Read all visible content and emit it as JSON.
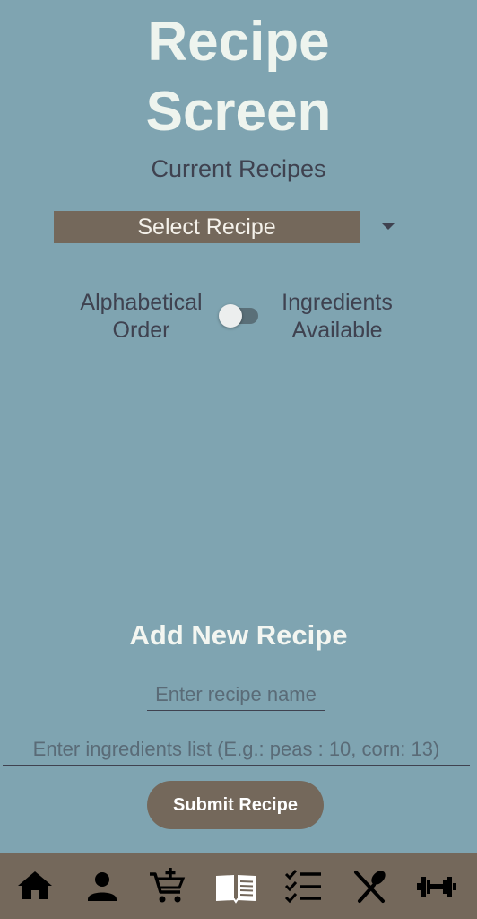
{
  "header": {
    "title_line1": "Recipe",
    "title_line2": "Screen",
    "subtitle": "Current Recipes"
  },
  "recipe_select": {
    "selected": "Select Recipe"
  },
  "sort_toggle": {
    "left_line1": "Alphabetical",
    "left_line2": "Order",
    "right_line1": "Ingredients",
    "right_line2": "Available",
    "state": "off"
  },
  "add_recipe": {
    "title": "Add New Recipe",
    "name_placeholder": "Enter recipe name",
    "name_value": "",
    "ingredients_placeholder": "Enter ingredients list (E.g.: peas : 10, corn: 13)",
    "ingredients_value": "",
    "submit_label": "Submit Recipe"
  },
  "bottom_nav": {
    "items": [
      {
        "icon": "home-icon"
      },
      {
        "icon": "person-icon"
      },
      {
        "icon": "cart-add-icon"
      },
      {
        "icon": "book-icon"
      },
      {
        "icon": "checklist-icon"
      },
      {
        "icon": "utensils-icon"
      },
      {
        "icon": "dumbbell-icon"
      }
    ]
  },
  "colors": {
    "background": "#7fa4b1",
    "accent": "#74685b",
    "title_text": "#eef4ee",
    "body_text": "#3f4250"
  }
}
